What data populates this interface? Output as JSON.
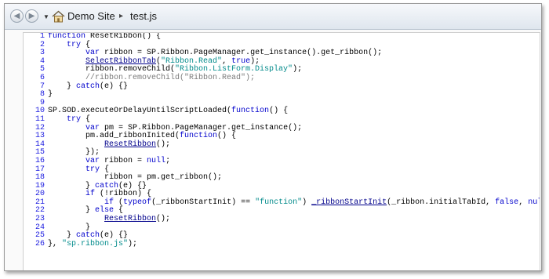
{
  "breadcrumb": {
    "site": "Demo Site",
    "separator": "▸",
    "file": "test.js"
  },
  "icons": {
    "back": "back-arrow-icon",
    "forward": "forward-arrow-icon",
    "dropdown": "dropdown-icon",
    "home": "home-icon"
  },
  "editor": {
    "line_numbers": [
      "1",
      "2",
      "3",
      "4",
      "5",
      "6",
      "7",
      "8",
      "9",
      "10",
      "11",
      "12",
      "13",
      "14",
      "15",
      "16",
      "17",
      "18",
      "19",
      "20",
      "21",
      "22",
      "23",
      "24",
      "25",
      "26"
    ],
    "lines": [
      [
        {
          "t": "function",
          "c": "kw"
        },
        {
          "t": " ResetRibbon() {"
        }
      ],
      [
        {
          "t": "    "
        },
        {
          "t": "try",
          "c": "kw"
        },
        {
          "t": " {"
        }
      ],
      [
        {
          "t": "        "
        },
        {
          "t": "var",
          "c": "kw"
        },
        {
          "t": " ribbon = SP.Ribbon.PageManager.get_instance().get_ribbon();"
        }
      ],
      [
        {
          "t": "        "
        },
        {
          "t": "SelectRibbonTab",
          "c": "link"
        },
        {
          "t": "("
        },
        {
          "t": "\"Ribbon.Read\"",
          "c": "str"
        },
        {
          "t": ", "
        },
        {
          "t": "true",
          "c": "kw"
        },
        {
          "t": ");"
        }
      ],
      [
        {
          "t": "        ribbon.removeChild("
        },
        {
          "t": "\"Ribbon.ListForm.Display\"",
          "c": "str"
        },
        {
          "t": ");"
        }
      ],
      [
        {
          "t": "        "
        },
        {
          "t": "//ribbon.removeChild(\"Ribbon.Read\");",
          "c": "cm"
        }
      ],
      [
        {
          "t": "    } "
        },
        {
          "t": "catch",
          "c": "kw"
        },
        {
          "t": "(e) {}"
        }
      ],
      [
        {
          "t": "}"
        }
      ],
      [
        {
          "t": ""
        }
      ],
      [
        {
          "t": "SP.SOD.executeOrDelayUntilScriptLoaded("
        },
        {
          "t": "function",
          "c": "kw"
        },
        {
          "t": "() {"
        }
      ],
      [
        {
          "t": "    "
        },
        {
          "t": "try",
          "c": "kw"
        },
        {
          "t": " {"
        }
      ],
      [
        {
          "t": "        "
        },
        {
          "t": "var",
          "c": "kw"
        },
        {
          "t": " pm = SP.Ribbon.PageManager.get_instance();"
        }
      ],
      [
        {
          "t": "        pm.add_ribbonInited("
        },
        {
          "t": "function",
          "c": "kw"
        },
        {
          "t": "() {"
        }
      ],
      [
        {
          "t": "            "
        },
        {
          "t": "ResetRibbon",
          "c": "link"
        },
        {
          "t": "();"
        }
      ],
      [
        {
          "t": "        });"
        }
      ],
      [
        {
          "t": "        "
        },
        {
          "t": "var",
          "c": "kw"
        },
        {
          "t": " ribbon = "
        },
        {
          "t": "null",
          "c": "kw"
        },
        {
          "t": ";"
        }
      ],
      [
        {
          "t": "        "
        },
        {
          "t": "try",
          "c": "kw"
        },
        {
          "t": " {"
        }
      ],
      [
        {
          "t": "            ribbon = pm.get_ribbon();"
        }
      ],
      [
        {
          "t": "        } "
        },
        {
          "t": "catch",
          "c": "kw"
        },
        {
          "t": "(e) {}"
        }
      ],
      [
        {
          "t": "        "
        },
        {
          "t": "if",
          "c": "kw"
        },
        {
          "t": " (!ribbon) {"
        }
      ],
      [
        {
          "t": "            "
        },
        {
          "t": "if",
          "c": "kw"
        },
        {
          "t": " ("
        },
        {
          "t": "typeof",
          "c": "kw"
        },
        {
          "t": "(_ribbonStartInit) == "
        },
        {
          "t": "\"function\"",
          "c": "str"
        },
        {
          "t": ") "
        },
        {
          "t": "_ribbonStartInit",
          "c": "link"
        },
        {
          "t": "(_ribbon.initialTabId, "
        },
        {
          "t": "false",
          "c": "kw"
        },
        {
          "t": ", "
        },
        {
          "t": "null",
          "c": "kw"
        },
        {
          "t": ");"
        }
      ],
      [
        {
          "t": "        } "
        },
        {
          "t": "else",
          "c": "kw"
        },
        {
          "t": " {"
        }
      ],
      [
        {
          "t": "            "
        },
        {
          "t": "ResetRibbon",
          "c": "link"
        },
        {
          "t": "();"
        }
      ],
      [
        {
          "t": "        }"
        }
      ],
      [
        {
          "t": "    } "
        },
        {
          "t": "catch",
          "c": "kw"
        },
        {
          "t": "(e) {}"
        }
      ],
      [
        {
          "t": "}, "
        },
        {
          "t": "\"sp.ribbon.js\"",
          "c": "str"
        },
        {
          "t": ");"
        }
      ]
    ]
  }
}
